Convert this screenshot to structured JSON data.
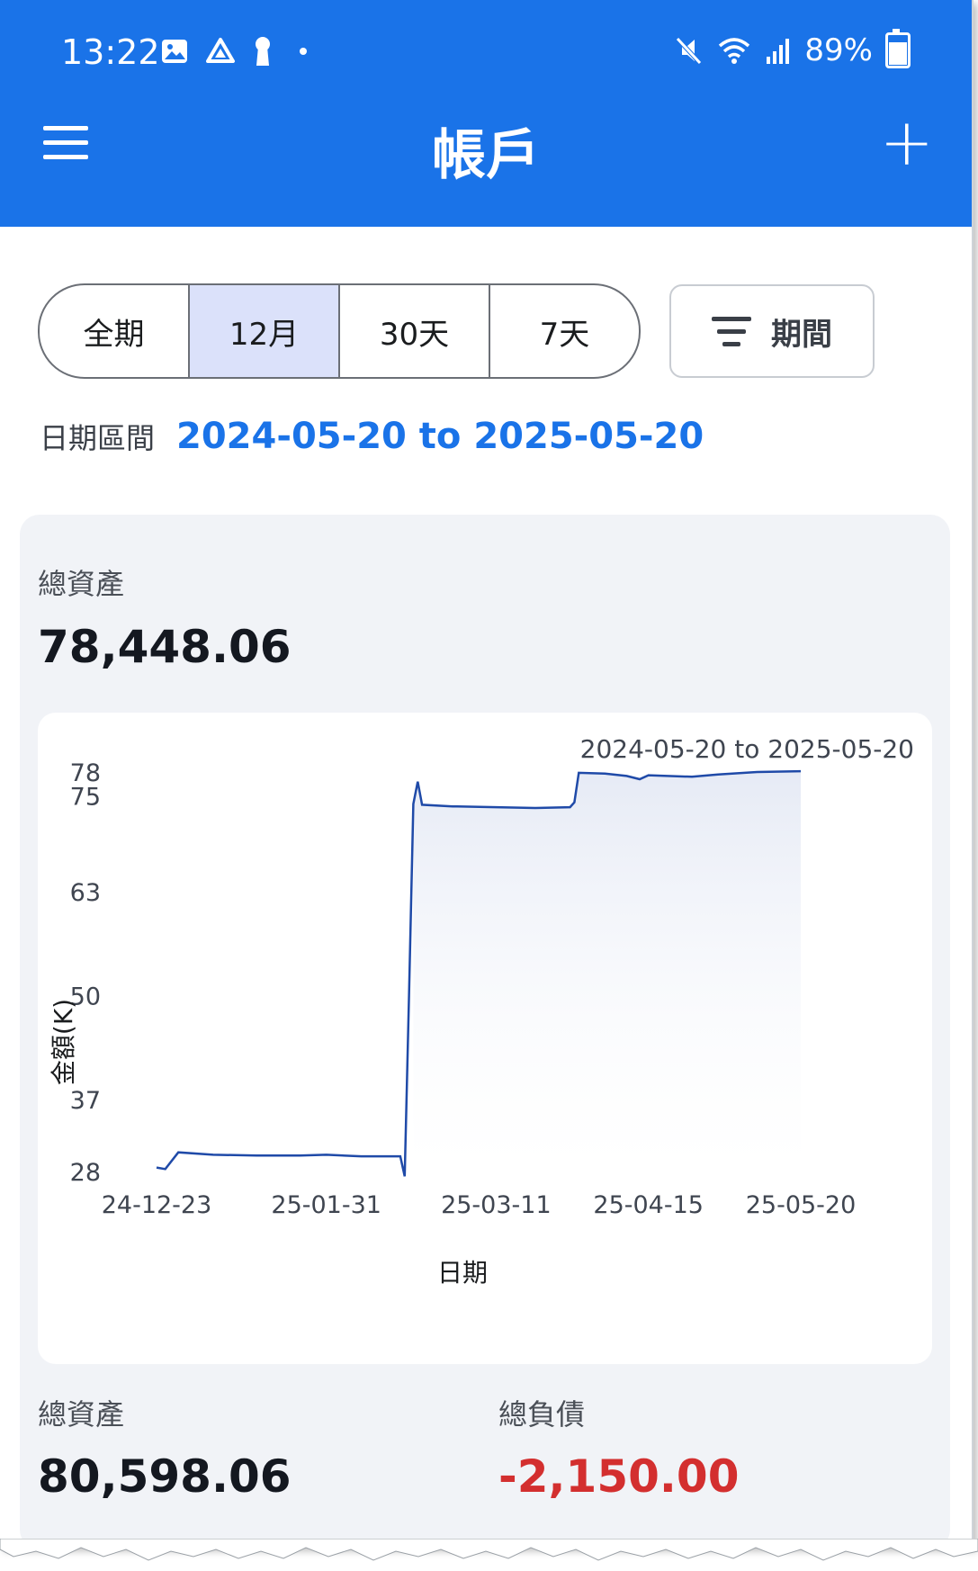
{
  "status_bar": {
    "time": "13:22",
    "battery": "89%",
    "battery_level": 0.89,
    "icons_left": [
      "image-icon",
      "drive-icon",
      "keyhole-icon",
      "dot-icon"
    ],
    "icons_right": [
      "mute-icon",
      "wifi-icon",
      "signal-icon",
      "battery-icon"
    ]
  },
  "header": {
    "title": "帳戶",
    "menu_icon": "menu-icon",
    "add_icon": "plus-icon",
    "color": "#1a73e8"
  },
  "segments": {
    "options": [
      "全期",
      "12月",
      "30天",
      "7天"
    ],
    "selected": "12月"
  },
  "period_button": {
    "label": "期間",
    "icon": "filter-icon"
  },
  "date_range": {
    "label": "日期區間",
    "value": "2024-05-20 to 2025-05-20"
  },
  "summary": {
    "label": "總資產",
    "value": "78,448.06"
  },
  "chart_data": {
    "type": "line",
    "title": "2024-05-20 to 2025-05-20",
    "xlabel": "日期",
    "ylabel": "金額(K)",
    "x_ticks": [
      "24-12-23",
      "25-01-31",
      "25-03-11",
      "25-04-15",
      "25-05-20"
    ],
    "y_ticks": [
      28,
      37,
      50,
      63,
      75,
      78
    ],
    "ylim": [
      28,
      78
    ],
    "series": [
      {
        "color": "#1f4aa8",
        "points": [
          [
            "24-12-23",
            28.5
          ],
          [
            "24-12-25",
            28.3
          ],
          [
            "24-12-28",
            30.4
          ],
          [
            "25-01-05",
            30.1
          ],
          [
            "25-01-15",
            30.0
          ],
          [
            "25-01-25",
            30.0
          ],
          [
            "25-01-31",
            30.1
          ],
          [
            "25-02-08",
            29.9
          ],
          [
            "25-02-17",
            29.9
          ],
          [
            "25-02-18",
            27.4
          ],
          [
            "25-02-19",
            50.0
          ],
          [
            "25-02-20",
            74.0
          ],
          [
            "25-02-21",
            76.8
          ],
          [
            "25-02-22",
            73.9
          ],
          [
            "25-03-01",
            73.7
          ],
          [
            "25-03-11",
            73.6
          ],
          [
            "25-03-20",
            73.5
          ],
          [
            "25-03-28",
            73.6
          ],
          [
            "25-03-29",
            74.2
          ],
          [
            "25-03-30",
            77.9
          ],
          [
            "25-04-05",
            77.8
          ],
          [
            "25-04-10",
            77.5
          ],
          [
            "25-04-13",
            77.1
          ],
          [
            "25-04-15",
            77.6
          ],
          [
            "25-04-25",
            77.4
          ],
          [
            "25-05-01",
            77.7
          ],
          [
            "25-05-10",
            78.0
          ],
          [
            "25-05-20",
            78.1
          ]
        ]
      }
    ],
    "area_fill": true
  },
  "totals": {
    "assets_label": "總資產",
    "assets_value": "80,598.06",
    "liabilities_label": "總負債",
    "liabilities_value": "-2,150.00",
    "liabilities_color": "#d32f2f"
  }
}
